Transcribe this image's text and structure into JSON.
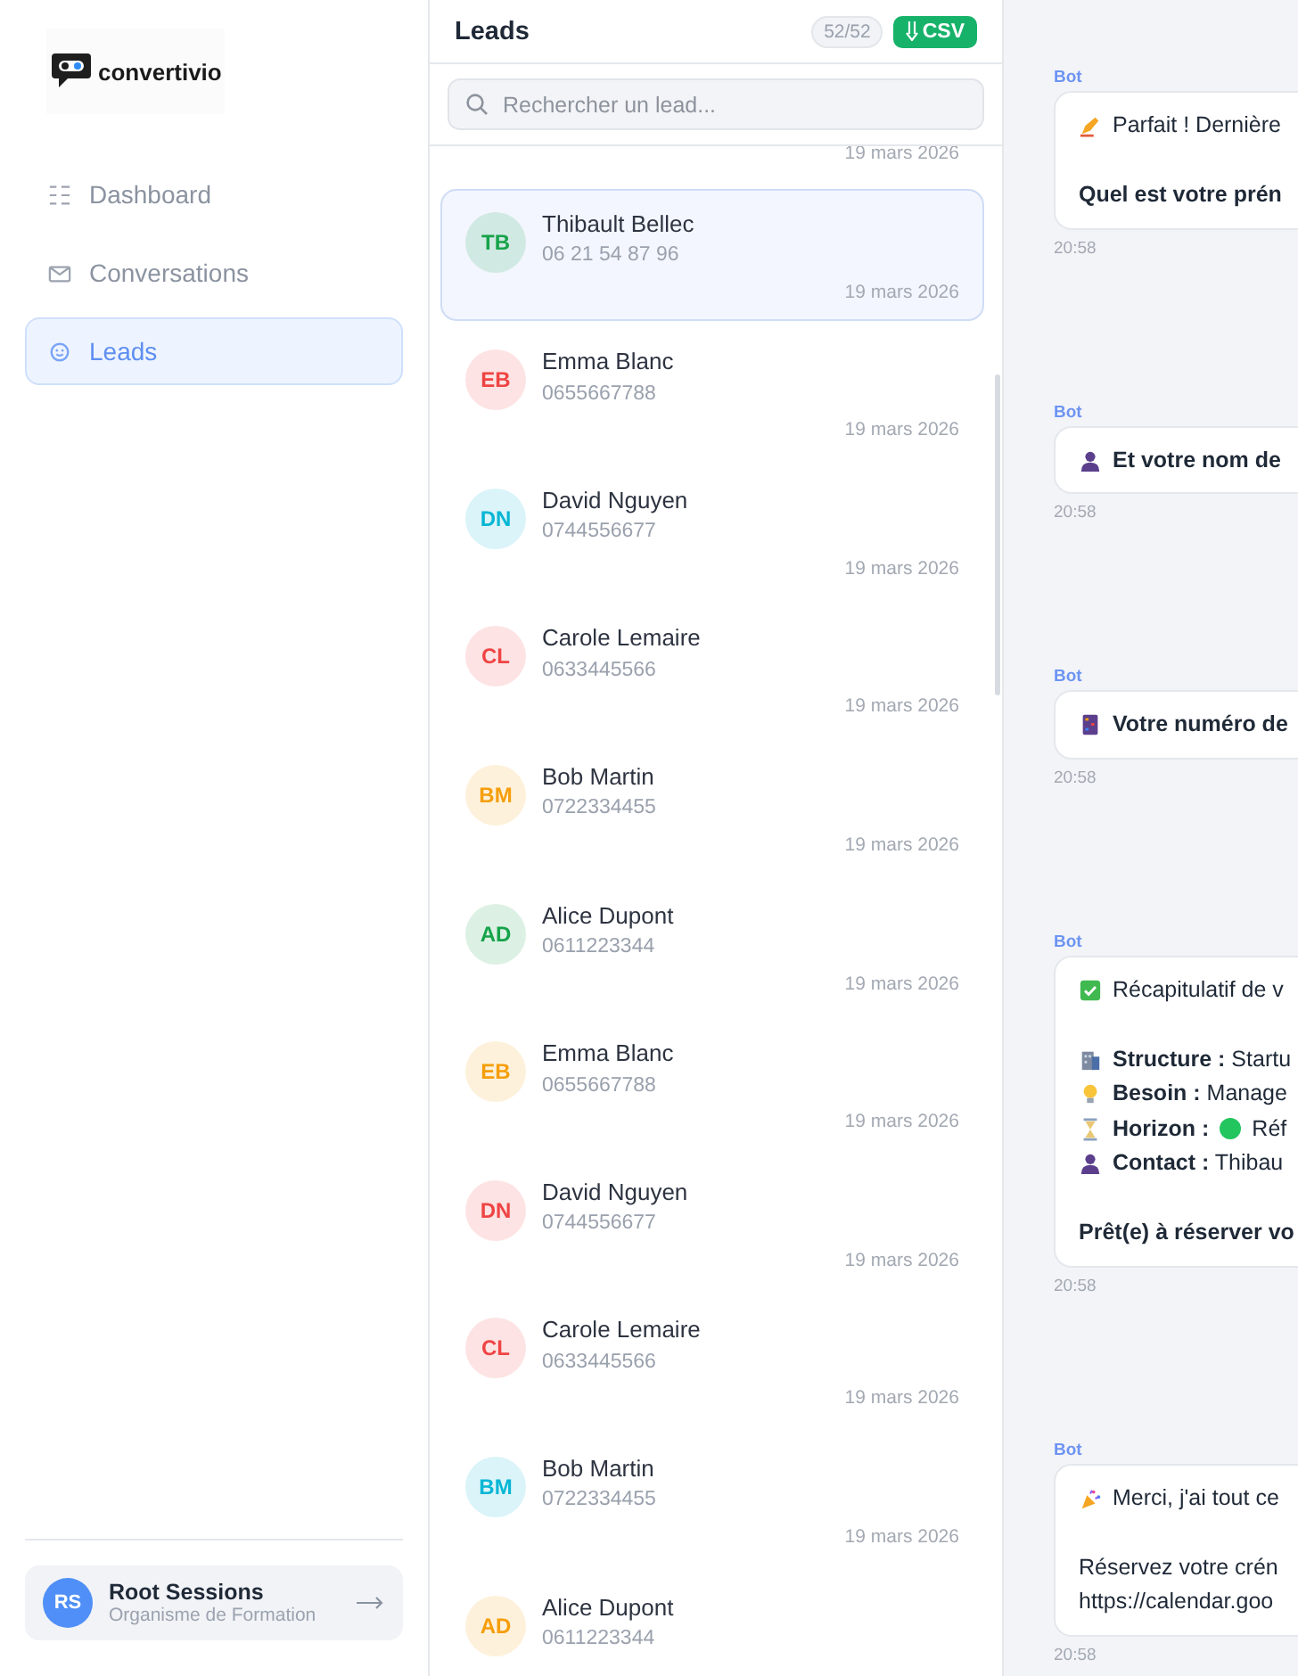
{
  "sidebar": {
    "logo": "convertivio",
    "items": [
      {
        "label": "Dashboard",
        "kind": "grid",
        "selected": false
      },
      {
        "label": "Conversations",
        "kind": "mail",
        "selected": false
      },
      {
        "label": "Leads",
        "kind": "smile",
        "selected": true
      }
    ],
    "account": {
      "initials": "RS",
      "name": "Root Sessions",
      "subtitle": "Organisme de Formation"
    }
  },
  "leads": {
    "title": "Leads",
    "count": "52/52",
    "export": "CSV",
    "search": {
      "placeholder": "Rechercher un lead..."
    },
    "previous_date": "19 mars 2026",
    "items": [
      {
        "initials": "TB",
        "name": "Thibault Bellec",
        "phone": "06 21 54 87 96",
        "date": "19 mars 2026",
        "color": "#16a34a",
        "selected": true
      },
      {
        "initials": "EB",
        "name": "Emma Blanc",
        "phone": "0655667788",
        "date": "19 mars 2026",
        "color": "#ef4444",
        "selected": false
      },
      {
        "initials": "DN",
        "name": "David Nguyen",
        "phone": "0744556677",
        "date": "19 mars 2026",
        "color": "#06b6d4",
        "selected": false
      },
      {
        "initials": "CL",
        "name": "Carole Lemaire",
        "phone": "0633445566",
        "date": "19 mars 2026",
        "color": "#ef4444",
        "selected": false
      },
      {
        "initials": "BM",
        "name": "Bob Martin",
        "phone": "0722334455",
        "date": "19 mars 2026",
        "color": "#f59e0b",
        "selected": false
      },
      {
        "initials": "AD",
        "name": "Alice Dupont",
        "phone": "0611223344",
        "date": "19 mars 2026",
        "color": "#16a34a",
        "selected": false
      },
      {
        "initials": "EB",
        "name": "Emma Blanc",
        "phone": "0655667788",
        "date": "19 mars 2026",
        "color": "#f59e0b",
        "selected": false
      },
      {
        "initials": "DN",
        "name": "David Nguyen",
        "phone": "0744556677",
        "date": "19 mars 2026",
        "color": "#ef4444",
        "selected": false
      },
      {
        "initials": "CL",
        "name": "Carole Lemaire",
        "phone": "0633445566",
        "date": "19 mars 2026",
        "color": "#ef4444",
        "selected": false
      },
      {
        "initials": "BM",
        "name": "Bob Martin",
        "phone": "0722334455",
        "date": "19 mars 2026",
        "color": "#06b6d4",
        "selected": false
      },
      {
        "initials": "AD",
        "name": "Alice Dupont",
        "phone": "0611223344",
        "color": "#f59e0b",
        "selected": false
      }
    ]
  },
  "chat": {
    "messages": [
      {
        "sender": "Bot",
        "time": "20:58",
        "lines": [
          {
            "kind": "writing",
            "text": "Parfait ! Dernière"
          },
          {
            "kind": "blank"
          },
          {
            "kind": "bold",
            "text": "Quel est votre prén"
          }
        ]
      },
      {
        "sender": "Bot",
        "time": "20:58",
        "lines": [
          {
            "kind": "person",
            "text": "**Et votre nom de**"
          }
        ]
      },
      {
        "sender": "Bot",
        "time": "20:58",
        "lines": [
          {
            "kind": "abacus",
            "text": "**Votre numéro de**"
          }
        ]
      },
      {
        "sender": "Bot",
        "time": "20:58",
        "lines": [
          {
            "kind": "check",
            "text": "Récapitulatif de v"
          },
          {
            "kind": "blank"
          },
          {
            "kind": "building",
            "text": "**Structure :** Startu"
          },
          {
            "kind": "bulb",
            "text": "**Besoin :** Manage"
          },
          {
            "kind": "hourglass",
            "text": "**Horizon :**",
            "color": "#22c55e",
            "after": "Réf"
          },
          {
            "kind": "person",
            "text": "**Contact :** Thibau"
          },
          {
            "kind": "blank"
          },
          {
            "kind": "bold",
            "text": "Prêt(e) à réserver vo"
          }
        ]
      },
      {
        "sender": "Bot",
        "time": "20:58",
        "lines": [
          {
            "kind": "party",
            "text": "Merci, j'ai tout ce"
          },
          {
            "kind": "blank"
          },
          {
            "kind": "plain",
            "text": "Réservez votre crén"
          },
          {
            "kind": "plain",
            "text": "https://calendar.goo"
          }
        ]
      }
    ]
  }
}
